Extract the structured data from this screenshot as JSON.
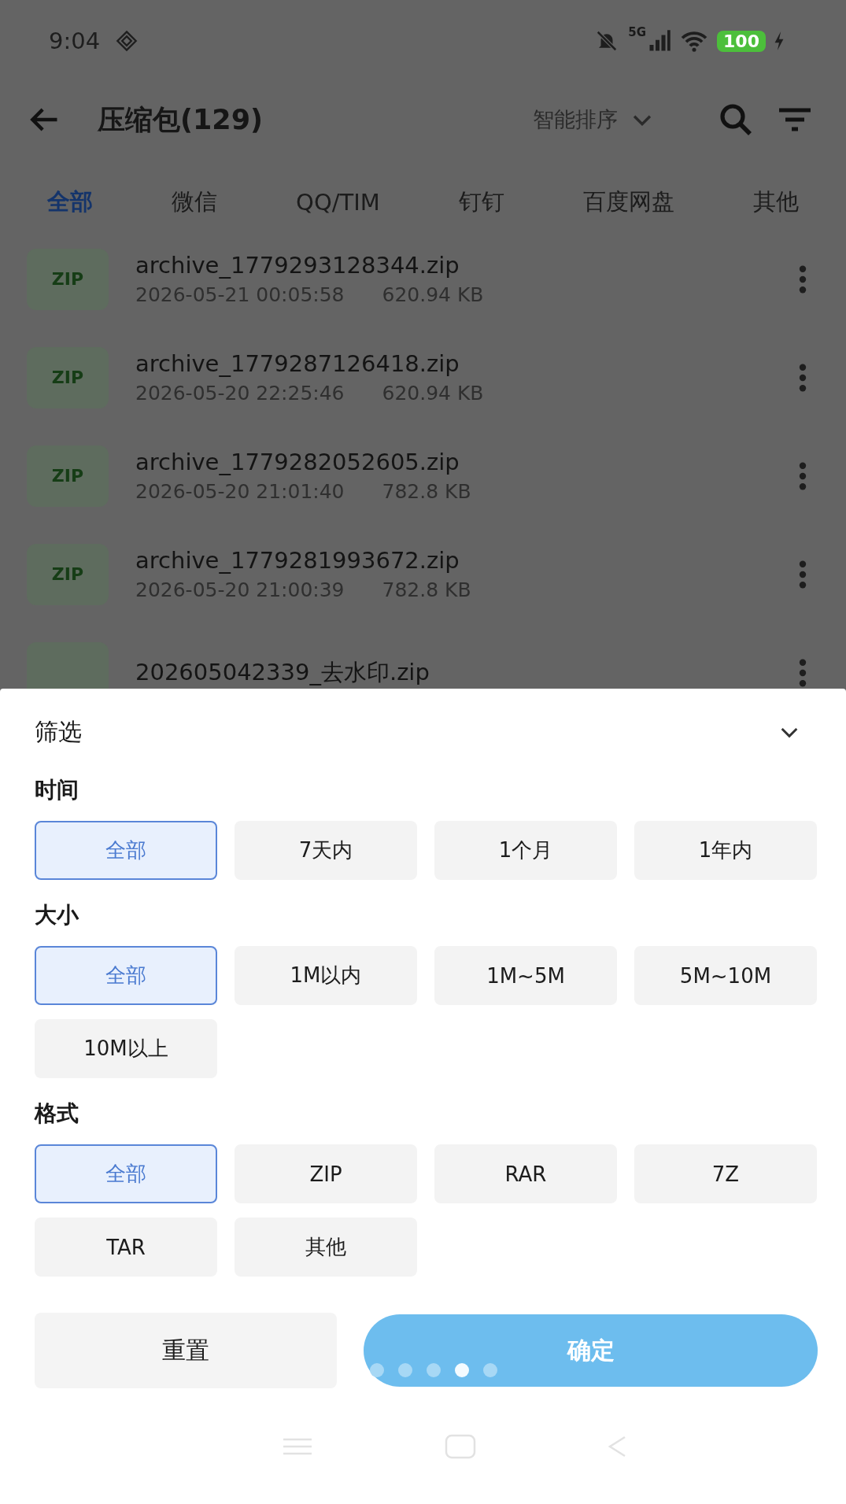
{
  "status_bar": {
    "time": "9:04",
    "network": "5G",
    "battery": "100"
  },
  "header": {
    "title": "压缩包(129)",
    "sort": "智能排序"
  },
  "tabs": [
    {
      "label": "全部",
      "selected": true
    },
    {
      "label": "微信",
      "selected": false
    },
    {
      "label": "QQ/TIM",
      "selected": false
    },
    {
      "label": "钉钉",
      "selected": false
    },
    {
      "label": "百度网盘",
      "selected": false
    },
    {
      "label": "其他",
      "selected": false
    }
  ],
  "files": [
    {
      "icon_label": "ZIP",
      "name": "archive_1779293128344.zip",
      "date": "2026-05-21 00:05:58",
      "size": "620.94 KB"
    },
    {
      "icon_label": "ZIP",
      "name": "archive_1779287126418.zip",
      "date": "2026-05-20 22:25:46",
      "size": "620.94 KB"
    },
    {
      "icon_label": "ZIP",
      "name": "archive_1779282052605.zip",
      "date": "2026-05-20 21:01:40",
      "size": "782.8 KB"
    },
    {
      "icon_label": "ZIP",
      "name": "archive_1779281993672.zip",
      "date": "2026-05-20 21:00:39",
      "size": "782.8 KB"
    },
    {
      "name": "202605042339_去水印.zip"
    }
  ],
  "filter_sheet": {
    "title": "筛选",
    "groups": [
      {
        "label": "时间",
        "options": [
          {
            "label": "全部",
            "selected": true
          },
          {
            "label": "7天内",
            "selected": false
          },
          {
            "label": "1个月",
            "selected": false
          },
          {
            "label": "1年内",
            "selected": false
          }
        ]
      },
      {
        "label": "大小",
        "options": [
          {
            "label": "全部",
            "selected": true
          },
          {
            "label": "1M以内",
            "selected": false
          },
          {
            "label": "1M~5M",
            "selected": false
          },
          {
            "label": "5M~10M",
            "selected": false
          },
          {
            "label": "10M以上",
            "selected": false
          }
        ]
      },
      {
        "label": "格式",
        "options": [
          {
            "label": "全部",
            "selected": true
          },
          {
            "label": "ZIP",
            "selected": false
          },
          {
            "label": "RAR",
            "selected": false
          },
          {
            "label": "7Z",
            "selected": false
          },
          {
            "label": "TAR",
            "selected": false
          },
          {
            "label": "其他",
            "selected": false
          }
        ]
      }
    ],
    "reset_button": "重置",
    "confirm_button": "确定"
  },
  "page_dots": [
    {
      "selected": false
    },
    {
      "selected": false
    },
    {
      "selected": false
    },
    {
      "selected": true
    },
    {
      "selected": false
    }
  ]
}
